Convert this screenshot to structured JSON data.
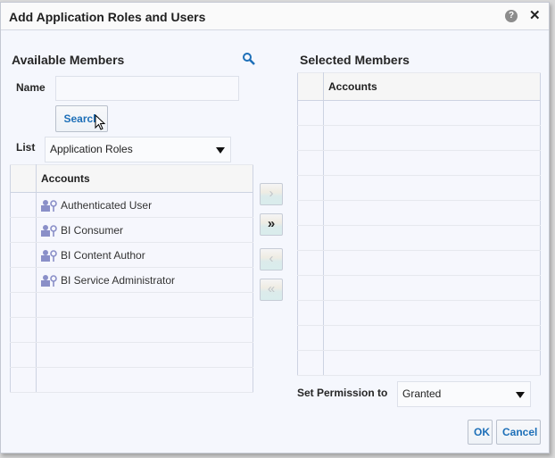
{
  "dialog": {
    "title": "Add Application Roles and Users",
    "help_icon": "help-icon",
    "close_icon": "close-icon"
  },
  "available": {
    "title": "Available Members",
    "search_icon": "magnifier-icon",
    "name_label": "Name",
    "name_value": "",
    "search_button": "Search",
    "list_label": "List",
    "list_value": "Application Roles",
    "column_header": "Accounts",
    "rows": [
      {
        "label": "Authenticated User",
        "icon": "application-role-icon"
      },
      {
        "label": "BI Consumer",
        "icon": "application-role-icon"
      },
      {
        "label": "BI Content Author",
        "icon": "application-role-icon"
      },
      {
        "label": "BI Service Administrator",
        "icon": "application-role-icon"
      },
      {
        "label": "",
        "icon": ""
      },
      {
        "label": "",
        "icon": ""
      },
      {
        "label": "",
        "icon": ""
      },
      {
        "label": "",
        "icon": ""
      }
    ]
  },
  "shuttle": {
    "move": "›",
    "move_all": "»",
    "remove": "‹",
    "remove_all": "«"
  },
  "selected": {
    "title": "Selected Members",
    "column_header": "Accounts",
    "row_count": 11
  },
  "permission": {
    "label": "Set Permission to",
    "value": "Granted"
  },
  "footer": {
    "ok": "OK",
    "cancel": "Cancel"
  }
}
